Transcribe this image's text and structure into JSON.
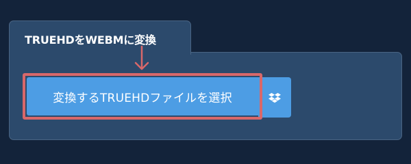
{
  "tab": {
    "title": "TRUEHDをWEBMに変換"
  },
  "uploader": {
    "select_button_label": "変換するTRUEHDファイルを選択",
    "dropbox_icon": "dropbox-icon"
  },
  "colors": {
    "background": "#13233a",
    "panel": "#2c4a6c",
    "button": "#4d9de4",
    "highlight": "#d9686a"
  }
}
